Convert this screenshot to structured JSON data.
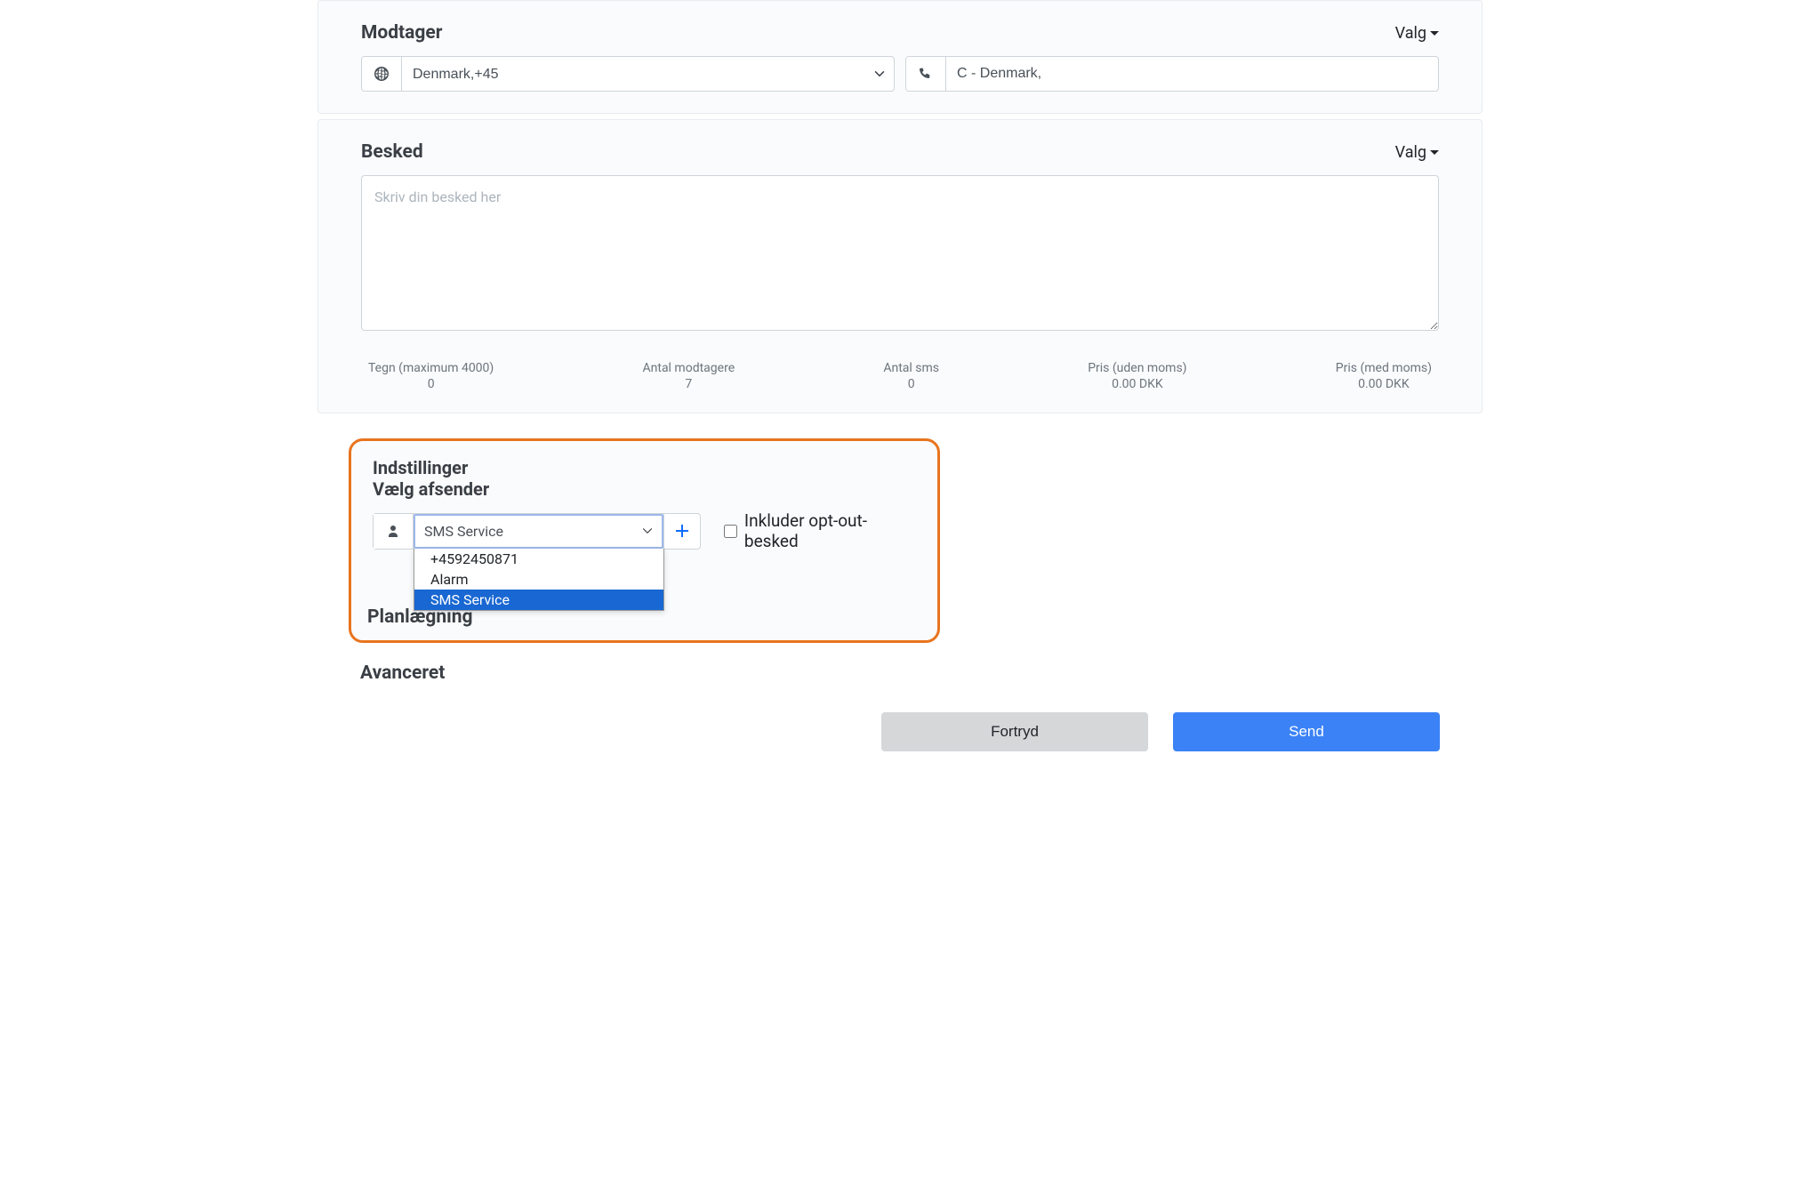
{
  "recipient": {
    "title": "Modtager",
    "options_label": "Valg",
    "country_value": "Denmark,+45",
    "phone_value": "C - Denmark,"
  },
  "message": {
    "title": "Besked",
    "options_label": "Valg",
    "placeholder": "Skriv din besked her",
    "stats": {
      "chars_label": "Tegn (maximum 4000)",
      "chars_value": "0",
      "recipients_label": "Antal modtagere",
      "recipients_value": "7",
      "sms_label": "Antal sms",
      "sms_value": "0",
      "price_ex_label": "Pris (uden moms)",
      "price_ex_value": "0.00 DKK",
      "price_inc_label": "Pris (med moms)",
      "price_inc_value": "0.00 DKK"
    }
  },
  "settings": {
    "title": "Indstillinger",
    "subtitle": "Vælg afsender",
    "sender_selected": "SMS Service",
    "options": [
      "+4592450871",
      "Alarm",
      "SMS Service"
    ],
    "optout_label": "Inkluder opt-out-besked"
  },
  "planning": {
    "title": "Planlægning"
  },
  "advanced": {
    "title": "Avanceret"
  },
  "footer": {
    "cancel": "Fortryd",
    "send": "Send"
  }
}
